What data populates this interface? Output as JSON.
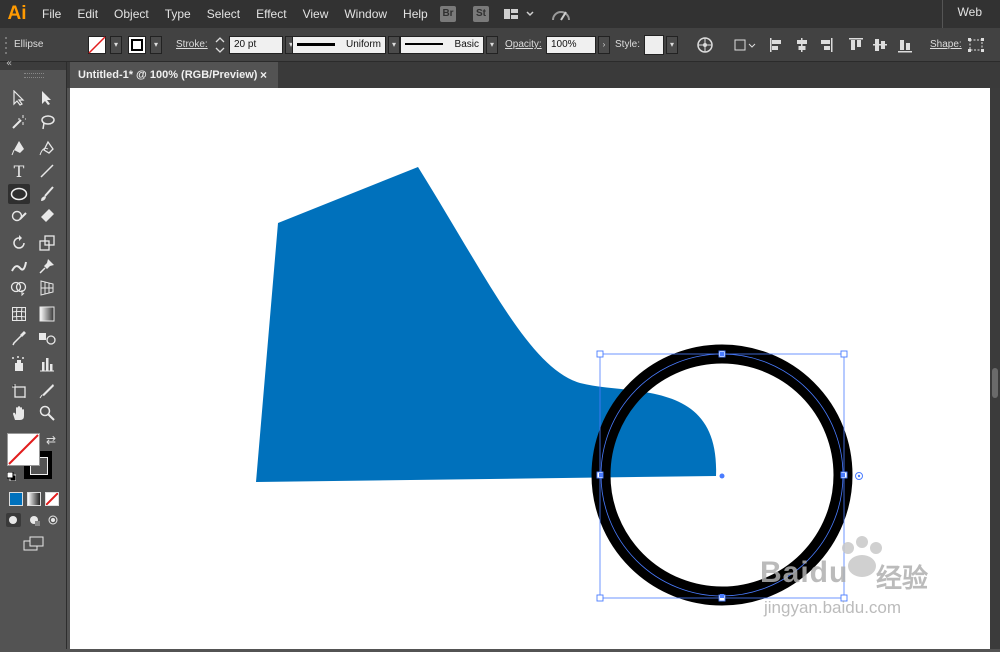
{
  "app": {
    "logo": "Ai",
    "workspace": "Web"
  },
  "menu": [
    "File",
    "Edit",
    "Object",
    "Type",
    "Select",
    "Effect",
    "View",
    "Window",
    "Help"
  ],
  "bridge_buttons": [
    "Br",
    "St"
  ],
  "control_bar": {
    "selection_type": "Ellipse",
    "stroke_label": "Stroke:",
    "stroke_weight": "20 pt",
    "profile": "Uniform",
    "brush": "Basic",
    "opacity_label": "Opacity:",
    "opacity": "100%",
    "style_label": "Style:",
    "shape_label": "Shape:"
  },
  "document": {
    "tab_title": "Untitled-1* @ 100% (RGB/Preview)",
    "close": "×"
  },
  "artwork": {
    "fill_color": "#0071bc",
    "stroke_color": "#000000",
    "selection_color": "#4a7cff"
  },
  "tools": [
    "selection-tool",
    "direct-selection-tool",
    "magic-wand-tool",
    "lasso-tool",
    "pen-tool",
    "curvature-tool",
    "type-tool",
    "line-tool",
    "ellipse-tool",
    "paintbrush-tool",
    "shaper-tool",
    "eraser-tool",
    "rotate-tool",
    "scale-tool",
    "warp-tool",
    "puppet-warp-tool",
    "shape-builder-tool",
    "perspective-grid-tool",
    "mesh-tool",
    "gradient-tool",
    "eyedropper-tool",
    "blend-tool",
    "symbol-sprayer-tool",
    "column-graph-tool",
    "artboard-tool",
    "slice-tool",
    "hand-tool",
    "zoom-tool"
  ],
  "watermark": {
    "brand": "Baidu",
    "cn": "经验",
    "url": "jingyan.baidu.com"
  }
}
